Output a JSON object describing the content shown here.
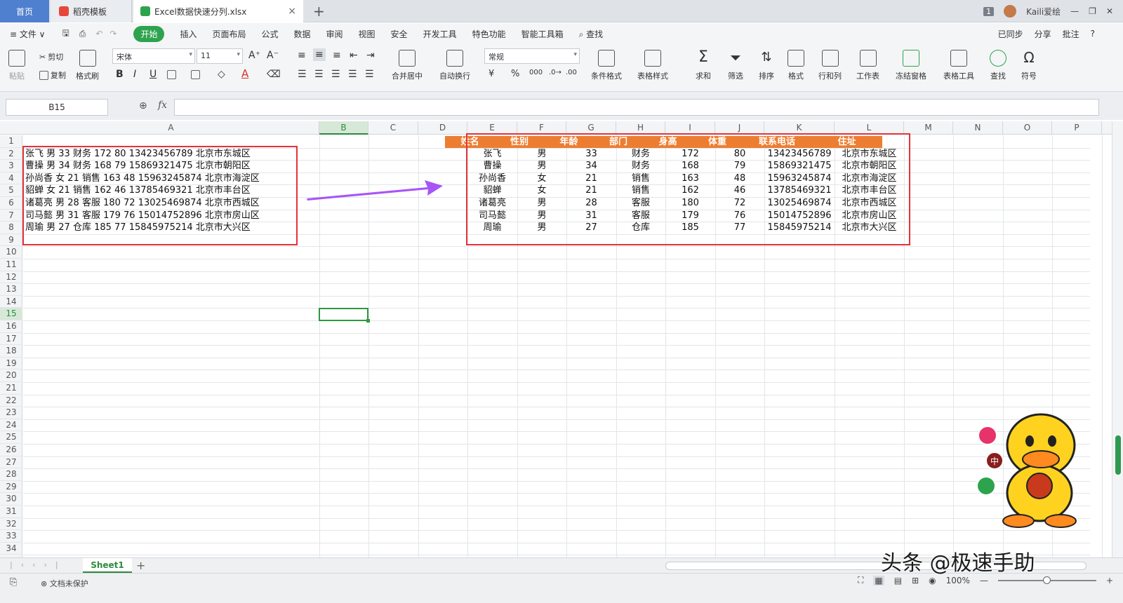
{
  "tabs": {
    "home": "首页",
    "template": "稻壳模板",
    "file": "Excel数据快速分列.xlsx",
    "close": "×",
    "new": "+"
  },
  "window": {
    "badge": "1",
    "user": "Kaili爱绘"
  },
  "menu": {
    "file": "≡ 文件 ∨",
    "items": [
      "开始",
      "插入",
      "页面布局",
      "公式",
      "数据",
      "审阅",
      "视图",
      "安全",
      "开发工具",
      "特色功能",
      "智能工具箱",
      "查找"
    ],
    "right": [
      "已同步",
      "分享",
      "批注",
      "?"
    ]
  },
  "ribbon": {
    "paste": "粘贴",
    "cut": "剪切",
    "copy": "复制",
    "format_painter": "格式刷",
    "font_name": "宋体",
    "font_size": "11",
    "merge": "合并居中",
    "wrap": "自动换行",
    "number_format": "常规",
    "conditional": "条件格式",
    "table_style": "表格样式",
    "sum": "求和",
    "filter": "筛选",
    "sort": "排序",
    "format": "格式",
    "rowcol": "行和列",
    "sheet": "工作表",
    "freeze": "冻结窗格",
    "table_tools": "表格工具",
    "find": "查找",
    "symbol": "符号"
  },
  "formula_bar": {
    "name_box": "B15",
    "fx": "fx",
    "value": ""
  },
  "columns": [
    "A",
    "B",
    "C",
    "D",
    "E",
    "F",
    "G",
    "H",
    "I",
    "J",
    "K",
    "L",
    "M",
    "N",
    "O",
    "P"
  ],
  "rows": [
    "1",
    "2",
    "3",
    "4",
    "5",
    "6",
    "7",
    "8",
    "9",
    "10",
    "11",
    "12",
    "13",
    "14",
    "15",
    "16",
    "17",
    "18",
    "19",
    "20",
    "21",
    "22",
    "23",
    "24",
    "25",
    "26",
    "27",
    "28",
    "29",
    "30",
    "31",
    "32",
    "33",
    "34"
  ],
  "raw_data": [
    "张飞 男 33 财务 172 80 13423456789 北京市东城区",
    "曹操 男 34 财务 168 79 15869321475 北京市朝阳区",
    "孙尚香 女 21 销售 163 48 15963245874 北京市海淀区",
    "貂蝉 女 21 销售 162 46 13785469321 北京市丰台区",
    "诸葛亮 男 28 客服 180 72 13025469874 北京市西城区",
    "司马懿 男 31 客服 179 76 15014752896 北京市房山区",
    "周瑜 男 27 仓库 185 77 15845975214 北京市大兴区"
  ],
  "table": {
    "headers": [
      "姓名",
      "性别",
      "年龄",
      "部门",
      "身高",
      "体重",
      "联系电话",
      "住址"
    ],
    "rows": [
      [
        "张飞",
        "男",
        "33",
        "财务",
        "172",
        "80",
        "13423456789",
        "北京市东城区"
      ],
      [
        "曹操",
        "男",
        "34",
        "财务",
        "168",
        "79",
        "15869321475",
        "北京市朝阳区"
      ],
      [
        "孙尚香",
        "女",
        "21",
        "销售",
        "163",
        "48",
        "15963245874",
        "北京市海淀区"
      ],
      [
        "貂蝉",
        "女",
        "21",
        "销售",
        "162",
        "46",
        "13785469321",
        "北京市丰台区"
      ],
      [
        "诸葛亮",
        "男",
        "28",
        "客服",
        "180",
        "72",
        "13025469874",
        "北京市西城区"
      ],
      [
        "司马懿",
        "男",
        "31",
        "客服",
        "179",
        "76",
        "15014752896",
        "北京市房山区"
      ],
      [
        "周瑜",
        "男",
        "27",
        "仓库",
        "185",
        "77",
        "15845975214",
        "北京市大兴区"
      ]
    ],
    "header_color": "#ed7d31"
  },
  "sheets": [
    "Sheet1"
  ],
  "status": {
    "protect": "文档未保护",
    "zoom": "100%"
  },
  "watermark": "头条 @极速手助",
  "colors": {
    "accent": "#2ea34e",
    "highlight_box": "#e5323b",
    "arrow": "#a855f7"
  }
}
